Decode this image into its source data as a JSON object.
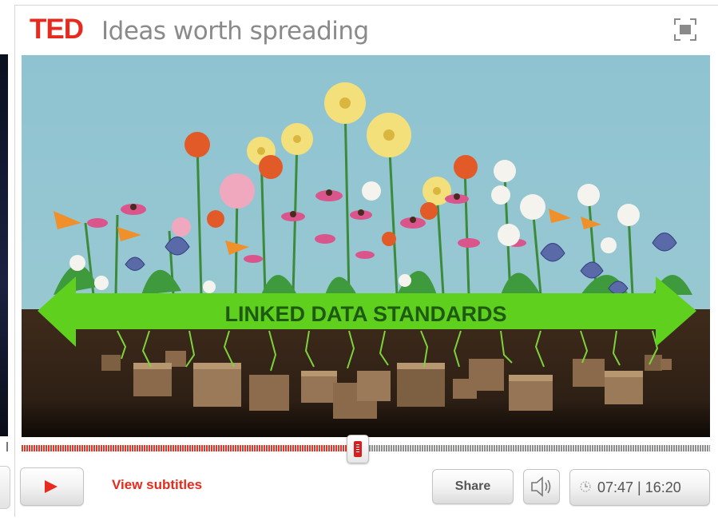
{
  "header": {
    "logo": "TED",
    "tagline": "Ideas worth spreading",
    "fullscreen_icon": "fullscreen-icon"
  },
  "video": {
    "banner_text": "LINKED DATA STANDARDS"
  },
  "progress": {
    "played_fraction": 0.488
  },
  "controls": {
    "play_icon": "play-icon",
    "subtitles_label": "View subtitles",
    "share_label": "Share",
    "volume_icon": "volume-icon",
    "clock_icon": "clock-icon",
    "current_time": "07:47",
    "time_separator": " | ",
    "total_time": "16:20"
  },
  "colors": {
    "brand_red": "#e62b1e",
    "banner_green": "#5fd01e",
    "sky": "#8ec3cf",
    "soil": "#3b2a1c"
  }
}
